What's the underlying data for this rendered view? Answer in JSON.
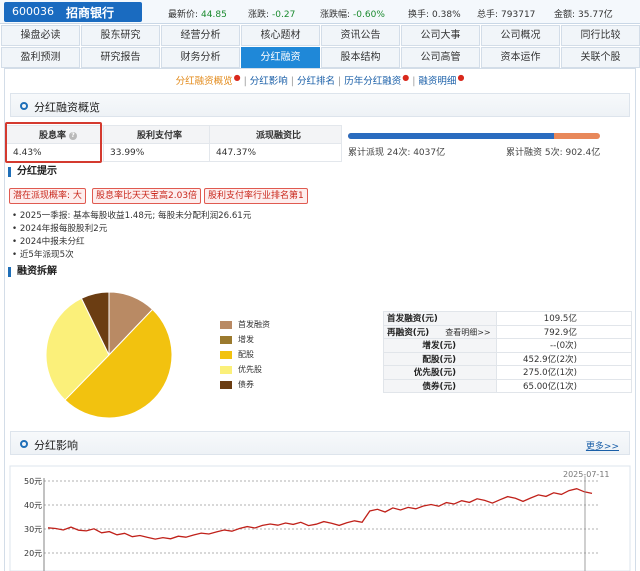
{
  "header": {
    "code": "600036",
    "name": "招商银行",
    "quotes": [
      {
        "label": "最新价:",
        "value": "44.85",
        "tone": "down"
      },
      {
        "label": "涨跌:",
        "value": "-0.27",
        "tone": "down"
      },
      {
        "label": "涨跌幅:",
        "value": "-0.60%",
        "tone": "down"
      },
      {
        "label": "换手:",
        "value": "0.38%",
        "tone": "plain"
      },
      {
        "label": "总手:",
        "value": "793717",
        "tone": "plain"
      },
      {
        "label": "金额:",
        "value": "35.77亿",
        "tone": "plain"
      }
    ]
  },
  "nav": {
    "rows": [
      [
        "操盘必读",
        "股东研究",
        "经营分析",
        "核心题材",
        "资讯公告",
        "公司大事",
        "公司概况",
        "同行比较"
      ],
      [
        "盈利预测",
        "研究报告",
        "财务分析",
        "分红融资",
        "股本结构",
        "公司高管",
        "资本运作",
        "关联个股"
      ]
    ],
    "active": "分红融资"
  },
  "subtabs": [
    {
      "label": "分红融资概览",
      "active": true,
      "dot": true
    },
    {
      "label": "分红影响",
      "active": false,
      "dot": false
    },
    {
      "label": "分红排名",
      "active": false,
      "dot": false
    },
    {
      "label": "历年分红融资",
      "active": false,
      "dot": true
    },
    {
      "label": "融资明细",
      "active": false,
      "dot": true
    }
  ],
  "overview": {
    "title": "分红融资概览",
    "metrics": {
      "headers": [
        "股息率",
        "股利支付率",
        "派现融资比"
      ],
      "values": [
        "4.43%",
        "33.99%",
        "447.37%"
      ]
    },
    "bar": {
      "dividend_share": 0.8173,
      "left_text": "累计派现 24次: 4037亿",
      "right_text": "累计融资 5次: 902.4亿",
      "left_color": "#2a6cbf",
      "right_color": "#e8885a"
    }
  },
  "tips": {
    "title": "分红提示",
    "tags": [
      "潜在派现概率: 大",
      "股息率比天天宝高2.03倍",
      "股利支付率行业排名第1"
    ],
    "notes": [
      "2025一季报: 基本每股收益1.48元; 每股未分配利润26.61元",
      "2024年报每股股利2元",
      "2024中报未分红",
      "近5年派现5次"
    ]
  },
  "financing": {
    "title": "融资拆解",
    "legend": [
      {
        "label": "首发融资",
        "color": "#b98a64"
      },
      {
        "label": "增发",
        "color": "#9b7a2e"
      },
      {
        "label": "配股",
        "color": "#f2c20f"
      },
      {
        "label": "优先股",
        "color": "#fbf07a"
      },
      {
        "label": "债券",
        "color": "#6b3d12"
      }
    ],
    "pie": [
      {
        "label": "首发融资",
        "value": 109.5,
        "color": "#b98a64"
      },
      {
        "label": "配股",
        "value": 452.9,
        "color": "#f2c20f"
      },
      {
        "label": "优先股",
        "value": 275.0,
        "color": "#fbf07a"
      },
      {
        "label": "债券",
        "value": 65.0,
        "color": "#6b3d12"
      }
    ],
    "table": [
      {
        "key": "首发融资(元)",
        "value": "109.5亿",
        "align": "left"
      },
      {
        "key": "再融资(元)",
        "value": "792.9亿",
        "align": "left",
        "detail": "查看明细>>"
      },
      {
        "key": "增发(元)",
        "value": "--(0次)",
        "align": "right"
      },
      {
        "key": "配股(元)",
        "value": "452.9亿(2次)",
        "align": "right"
      },
      {
        "key": "优先股(元)",
        "value": "275.0亿(1次)",
        "align": "right"
      },
      {
        "key": "债券(元)",
        "value": "65.00亿(1次)",
        "align": "right"
      }
    ]
  },
  "impact": {
    "title": "分红影响",
    "more": "更多>>"
  },
  "chart_data": {
    "type": "line",
    "yticks": [
      "50元",
      "40元",
      "30元",
      "20元"
    ],
    "ylim": [
      20,
      50
    ],
    "date_label": "2025-07-11",
    "line_color": "#c0211a",
    "series": [
      {
        "values": [
          30.5,
          30.2,
          29.6,
          30.8,
          29.5,
          29.2,
          30.1,
          28.4,
          28.9,
          27.6,
          28.2,
          26.8,
          27.3,
          26.5,
          25.8,
          26.4,
          25.9,
          27.0,
          26.6,
          27.5,
          28.3,
          27.9,
          28.8,
          29.6,
          29.1,
          30.2,
          31.0,
          30.4,
          31.5,
          32.1,
          31.6,
          32.5,
          31.9,
          32.8,
          31.4,
          32.0,
          33.1,
          32.4,
          31.5,
          32.6,
          33.4,
          32.8,
          37.5,
          38.2,
          37.1,
          38.8,
          37.9,
          39.0,
          38.4,
          39.6,
          40.2,
          39.5,
          41.0,
          40.4,
          41.8,
          41.1,
          42.6,
          41.9,
          40.8,
          42.2,
          43.5,
          42.8,
          41.5,
          42.9,
          44.2,
          43.6,
          45.1,
          44.4,
          46.0,
          46.8,
          45.5,
          44.85
        ]
      }
    ]
  }
}
